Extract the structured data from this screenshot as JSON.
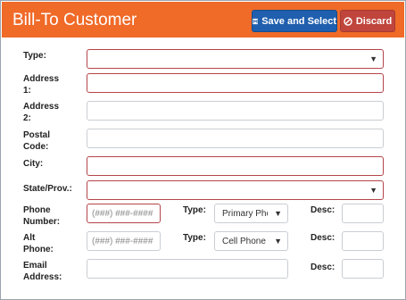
{
  "header": {
    "title": "Bill-To Customer",
    "save_label": "Save and Select",
    "discard_label": "Discard"
  },
  "form": {
    "type_label": "Type:",
    "type_value": "",
    "address1_label_a": "Address",
    "address1_label_b": "1:",
    "address2_label_a": "Address",
    "address2_label_b": "2:",
    "postal_label_a": "Postal",
    "postal_label_b": "Code:",
    "city_label": "City:",
    "state_label": "State/Prov.:",
    "state_value": "",
    "phone_label_a": "Phone",
    "phone_label_b": "Number:",
    "phone_placeholder": "(###) ###-####",
    "phone_type_label": "Type:",
    "phone_type_value": "Primary Phone",
    "phone_desc_label": "Desc:",
    "alt_label_a": "Alt",
    "alt_label_b": "Phone:",
    "alt_placeholder": "(###) ###-####",
    "alt_type_label": "Type:",
    "alt_type_value": "Cell Phone",
    "alt_desc_label": "Desc:",
    "email_label_a": "Email",
    "email_label_b": "Address:",
    "email_desc_label": "Desc:"
  },
  "colors": {
    "header_bg": "#f06a28",
    "save_bg": "#1f5fae",
    "discard_bg": "#c0453c",
    "required_border": "#b4454a"
  },
  "icons": {
    "save": "floppy-disk-icon",
    "discard": "ban-icon",
    "dropdown": "caret-down-icon"
  }
}
